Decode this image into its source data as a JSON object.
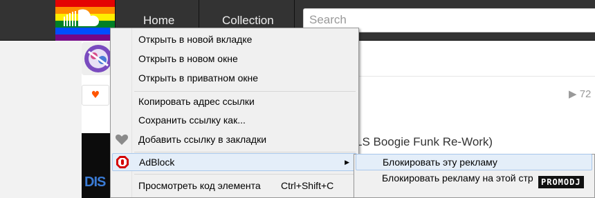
{
  "header": {
    "nav_home": "Home",
    "nav_collection": "Collection",
    "search_placeholder": "Search",
    "logo_icon": "soundcloud-rainbow-logo-icon",
    "bg_color": "#333333"
  },
  "stream": {
    "plays_count": "▶ 72",
    "track_title": "LS Boogie Funk Re-Work)",
    "like_icon": "heart-icon",
    "artwork_text": "DIS"
  },
  "context_menu": {
    "items": [
      {
        "label": "Открыть в новой вкладке"
      },
      {
        "label": "Открыть в новом окне"
      },
      {
        "label": "Открыть в приватном окне"
      },
      {
        "label": "Копировать адрес ссылки"
      },
      {
        "label": "Сохранить ссылку как..."
      },
      {
        "label": "Добавить ссылку в закладки",
        "icon": "heart-bookmark-icon"
      },
      {
        "label": "AdBlock",
        "icon": "adblock-icon",
        "has_submenu": true
      },
      {
        "label": "Просмотреть код элемента",
        "shortcut": "Ctrl+Shift+C"
      }
    ]
  },
  "adblock_submenu": {
    "items": [
      {
        "label": "Блокировать эту рекламу"
      },
      {
        "label": "Блокировать рекламу на этой стр"
      }
    ]
  },
  "watermark": {
    "text": "PROMODJ"
  },
  "colors": {
    "menu_bg": "#f0f0f0",
    "menu_highlight": "#e4eef9",
    "menu_highlight_border": "#a9c8ec",
    "accent": "#ff5500"
  }
}
